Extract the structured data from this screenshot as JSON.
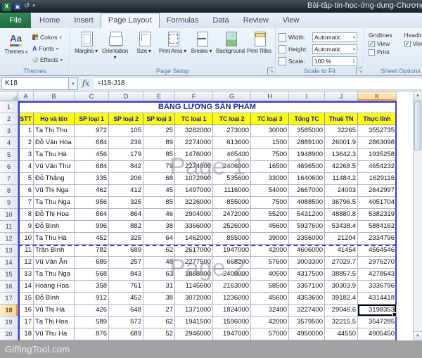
{
  "titlebar": {
    "title": "Bài-tập-tin-học-ứng-dụng-Chương"
  },
  "ribbon": {
    "tabs": [
      "File",
      "Home",
      "Insert",
      "Page Layout",
      "Formulas",
      "Data",
      "Review",
      "View"
    ],
    "active_tab": "Page Layout",
    "themes_group": {
      "label": "Themes",
      "big_button": "Themes",
      "colors": "Colors",
      "fonts": "Fonts",
      "effects": "Effects"
    },
    "page_setup_group": {
      "label": "Page Setup",
      "buttons": [
        "Margins",
        "Orientation",
        "Size",
        "Print Area",
        "Breaks",
        "Background",
        "Print Titles"
      ]
    },
    "scale_group": {
      "label": "Scale to Fit",
      "width_label": "Width:",
      "width_value": "Automatic",
      "height_label": "Height:",
      "height_value": "Automatic",
      "scale_label": "Scale:",
      "scale_value": "100 %"
    },
    "sheet_options_group": {
      "label": "Sheet Options",
      "gridlines_title": "Gridlines",
      "headings_title": "Headings",
      "view_label": "View",
      "print_label": "Print",
      "gridlines_view_checked": true,
      "gridlines_print_checked": false,
      "headings_view_checked": true
    }
  },
  "formula_bar": {
    "name_box": "K18",
    "fx_label": "fx",
    "formula": "=I18-J18"
  },
  "grid": {
    "column_letters": [
      "A",
      "B",
      "C",
      "D",
      "E",
      "F",
      "G",
      "H",
      "I",
      "J",
      "K"
    ],
    "selected_cell": "K18",
    "selected_column": "K",
    "selected_row": 18,
    "title_row": "BẢNG LƯƠNG SẢN PHẨM",
    "header_row": [
      "STT",
      "Họ và tên",
      "SP loại 1",
      "SP loại 2",
      "SP loại 3",
      "TC loại 1",
      "TC loại 2",
      "TC loại 3",
      "Tổng TC",
      "Thuế TN",
      "Thực lĩnh"
    ],
    "rows": [
      [
        1,
        "Tạ Thị Thu",
        972,
        105,
        25,
        3282000,
        273000,
        30000,
        3585000,
        32265,
        3552735
      ],
      [
        2,
        "Đỗ Văn Hòa",
        684,
        236,
        89,
        2274000,
        613600,
        1500,
        2889100,
        26001.9,
        2863098
      ],
      [
        3,
        "Tạ Thu Hà",
        456,
        179,
        85,
        1476000,
        465400,
        7500,
        1948900,
        13642.3,
        1935258
      ],
      [
        4,
        "Vũ Văn Thư",
        684,
        842,
        79,
        2274000,
        2406000,
        16500,
        4696500,
        42268.5,
        4654232
      ],
      [
        5,
        "Đỗ Thắng",
        335,
        206,
        68,
        1072000,
        535600,
        33000,
        1640600,
        11484.2,
        1629116
      ],
      [
        6,
        "Vũ Thị Nga",
        462,
        412,
        45,
        1497000,
        1116000,
        54000,
        2667000,
        24003,
        2642997
      ],
      [
        7,
        "Tạ Thu Nga",
        956,
        325,
        85,
        3226000,
        855000,
        7500,
        4088500,
        36796.5,
        4051704
      ],
      [
        8,
        "Đỗ Thị Hoa",
        864,
        864,
        46,
        2904000,
        2472000,
        55200,
        5431200,
        48880.8,
        5382319
      ],
      [
        9,
        "Đỗ Bình",
        996,
        882,
        38,
        3366000,
        2526000,
        45600,
        5937600,
        53438.4,
        5884162
      ],
      [
        10,
        "Tạ Thu Hà",
        452,
        325,
        64,
        1462000,
        855000,
        39000,
        2356000,
        21204,
        2334796
      ],
      [
        11,
        "Trần Bình",
        782,
        689,
        62,
        2617000,
        1947000,
        42000,
        4606000,
        41454,
        4564546
      ],
      [
        12,
        "Vũ Văn Ân",
        685,
        257,
        48,
        2277500,
        668200,
        57600,
        3003300,
        27029.7,
        2976270
      ],
      [
        13,
        "Tạ Thu Nga",
        568,
        843,
        63,
        1868000,
        2409000,
        40500,
        4317500,
        38857.5,
        4278643
      ],
      [
        14,
        "Hoàng Hoa",
        358,
        761,
        31,
        1145600,
        2163000,
        58500,
        3367100,
        30303.9,
        3336796
      ],
      [
        15,
        "Đỗ Bình",
        912,
        452,
        38,
        3072000,
        1236000,
        45600,
        4353600,
        39182.4,
        4314418
      ],
      [
        16,
        "Vũ Thị Hà",
        426,
        648,
        27,
        1371000,
        1824000,
        32400,
        3227400,
        29046.6,
        3198353
      ],
      [
        17,
        "Tạ Thị Hoa",
        589,
        572,
        62,
        1941500,
        1596000,
        42000,
        3579500,
        32215.5,
        3547285
      ],
      [
        18,
        "Vũ Thu Hà",
        876,
        689,
        52,
        2946000,
        1947000,
        57000,
        4950000,
        44550,
        4905450
      ]
    ],
    "watermarks": [
      "Page 1",
      "Page 2"
    ]
  },
  "footer": {
    "watermark": "GiffingTool.com"
  }
}
